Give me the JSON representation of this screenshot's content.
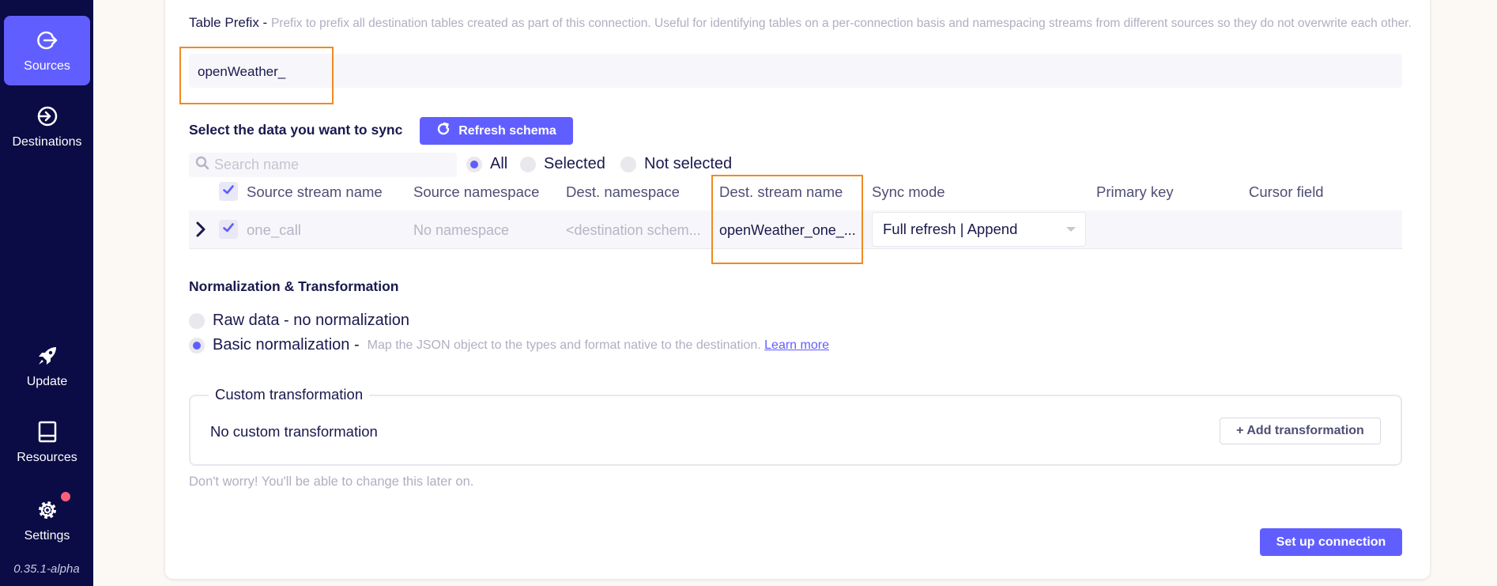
{
  "sidebar": {
    "items": [
      {
        "label": "Sources",
        "icon": "source-arrow-icon",
        "active": true
      },
      {
        "label": "Destinations",
        "icon": "destination-arrow-icon",
        "active": false
      },
      {
        "label": "Update",
        "icon": "rocket-icon",
        "active": false
      },
      {
        "label": "Resources",
        "icon": "book-icon",
        "active": false
      },
      {
        "label": "Settings",
        "icon": "gear-icon",
        "active": false
      }
    ],
    "version": "0.35.1-alpha"
  },
  "table_prefix": {
    "label": "Table Prefix -",
    "hint": "Prefix to prefix all destination tables created as part of this connection. Useful for identifying tables on a per-connection basis and namespacing streams from different sources so they do not overwrite each other.",
    "value": "openWeather_"
  },
  "sync": {
    "title": "Select the data you want to sync",
    "refresh_label": "Refresh schema",
    "search_placeholder": "Search name",
    "filters": [
      {
        "label": "All",
        "selected": true
      },
      {
        "label": "Selected",
        "selected": false
      },
      {
        "label": "Not selected",
        "selected": false
      }
    ],
    "columns": [
      "Source stream name",
      "Source namespace",
      "Dest. namespace",
      "Dest. stream name",
      "Sync mode",
      "Primary key",
      "Cursor field"
    ],
    "rows": [
      {
        "source_stream": "one_call",
        "source_namespace": "No namespace",
        "dest_namespace": "<destination schem...",
        "dest_stream": "openWeather_one_...",
        "sync_mode": "Full refresh | Append",
        "primary_key": "",
        "cursor_field": ""
      }
    ]
  },
  "normalization": {
    "title": "Normalization & Transformation",
    "options": [
      {
        "label": "Raw data - no normalization",
        "selected": false
      },
      {
        "label": "Basic normalization -",
        "selected": true
      }
    ],
    "basic_hint": "Map the JSON object to the types and format native to the destination.",
    "learn_more": "Learn more"
  },
  "transformation": {
    "legend": "Custom transformation",
    "empty_text": "No custom transformation",
    "add_label": "+ Add transformation"
  },
  "footer_note": "Don't worry! You'll be able to change this later on.",
  "submit_label": "Set up connection",
  "colors": {
    "sidebar_bg": "#0b0b45",
    "accent": "#615eff",
    "highlight": "#f08a24",
    "notification": "#ff5e7b"
  }
}
